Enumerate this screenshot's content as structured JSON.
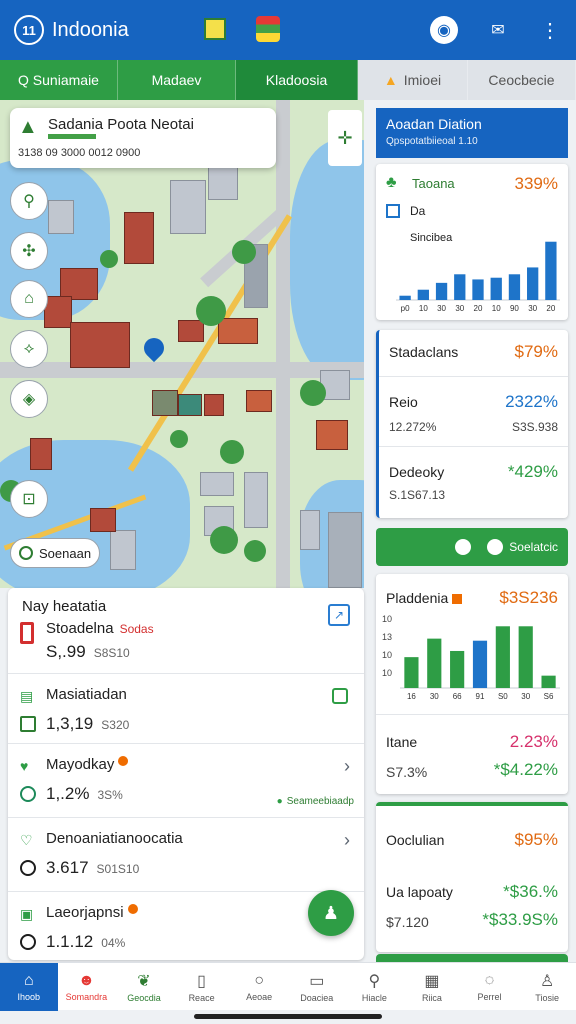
{
  "app": {
    "logo_text": "11",
    "title": "Indoonia"
  },
  "header_icons": [
    "flag-icon",
    "globe-icon",
    "account-icon",
    "notification-icon",
    "more-icon"
  ],
  "tabs": [
    {
      "label": "Q Suniamaie"
    },
    {
      "label": "Madaev"
    },
    {
      "label": "Kladoosia"
    },
    {
      "label": "Imioei"
    },
    {
      "label": "Ceocbecie"
    }
  ],
  "map": {
    "callout": {
      "title": "Sadania Poota Neotai",
      "subtitle": "3138 09 3000 0012 0900"
    },
    "search": {
      "label": "Soenaan"
    }
  },
  "list": {
    "items": [
      {
        "name": "Nay heatatia",
        "secondary": "Stoadelna",
        "secondary_tag": "Sodas",
        "value": "S,.99",
        "sub": "S8S10"
      },
      {
        "name": "Masiatiadan",
        "value": "1,3,19",
        "sub": "S320"
      },
      {
        "name": "Mayodkay",
        "value": "1,.2%",
        "sub": "3S%",
        "tag": "Seameebiaadp"
      },
      {
        "name": "Denoaniatianoocatia",
        "value": "3.617",
        "sub": "S01S10"
      },
      {
        "name": "Laeorjapnsi",
        "value": "1.1.12",
        "sub": "04%"
      }
    ]
  },
  "right": {
    "header": {
      "title": "Aoadan Diation",
      "subtitle": "Qpspotatbiieoal 1.10"
    },
    "card1": {
      "r1_label": "Taoana",
      "r1_value": "339%",
      "r2_label": "Da",
      "r3_label": "Sincibea"
    },
    "card2": {
      "r1_label": "Stadaclans",
      "r1_value": "$79%",
      "r2_label": "Reio",
      "r2_value": "2322%",
      "r2_sub": "12.272%",
      "r2_sub2": "S3S.938",
      "r3_label": "Dedeoky",
      "r3_value": "*429%",
      "r3_sub": "S.1S67.13"
    },
    "greenbar": {
      "label": "Soelatcic"
    },
    "card3": {
      "r1_label": "Pladdenia",
      "r1_value": "$3S236",
      "r2_label": "Itane",
      "r2_value": "2.23%",
      "r2_sub": "S7.3%",
      "r2_sub2": "*$4.22%"
    },
    "card4": {
      "r1_label": "Ooclulian",
      "r1_value": "$95%",
      "r2_label": "Ua lapoaty",
      "r2_value": "*$36.%",
      "r2_sub": "$7.120",
      "r2_sub2": "*$33.9S%"
    }
  },
  "chart_data": [
    {
      "type": "bar",
      "categories": [
        "p0",
        "10",
        "30",
        "30",
        "20",
        "10",
        "90",
        "30",
        "20"
      ],
      "values": [
        5,
        12,
        20,
        30,
        24,
        26,
        30,
        38,
        68
      ],
      "colors": [
        "#1e74c9"
      ],
      "ylim": [
        0,
        70
      ]
    },
    {
      "type": "bar",
      "yticks": [
        "10",
        "13",
        "10",
        "10"
      ],
      "categories": [
        "16",
        "30",
        "66",
        "91",
        "S0",
        "30",
        "S6"
      ],
      "values": [
        30,
        48,
        36,
        46,
        60,
        60,
        12
      ],
      "colors": [
        "#2e9d45",
        "#2e9d45",
        "#2e9d45",
        "#1e74c9",
        "#2e9d45",
        "#2e9d45",
        "#2e9d45"
      ],
      "ylim": [
        0,
        70
      ]
    }
  ],
  "bottom_nav": [
    {
      "label": "Ihoob",
      "icon": "home-icon"
    },
    {
      "label": "Somandra",
      "icon": "user-icon"
    },
    {
      "label": "Geocdia",
      "icon": "leaf-icon"
    },
    {
      "label": "Reace",
      "icon": "book-icon"
    },
    {
      "label": "Aeoae",
      "icon": "map-icon"
    },
    {
      "label": "Doaciea",
      "icon": "doc-icon"
    },
    {
      "label": "Hiacle",
      "icon": "search-icon"
    },
    {
      "label": "Riica",
      "icon": "grid-icon"
    },
    {
      "label": "Perrel",
      "icon": "chat-icon"
    },
    {
      "label": "Tiosie",
      "icon": "profile-icon"
    }
  ]
}
